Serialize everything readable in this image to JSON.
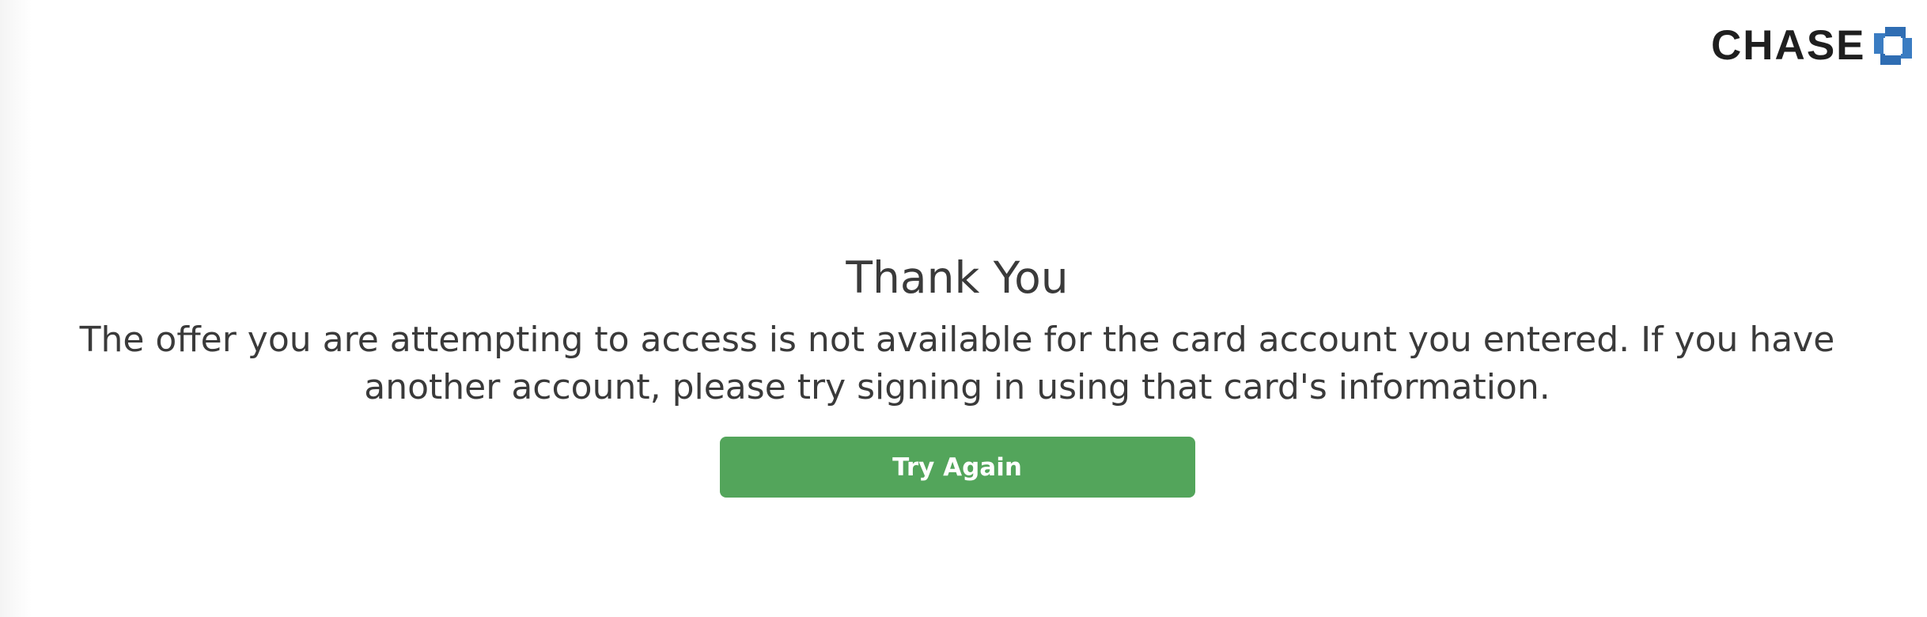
{
  "brand": {
    "name": "CHASE",
    "logo_icon": "chase-octagon-logo",
    "logo_color": "#2f6db3"
  },
  "page": {
    "title": "Thank You",
    "message": "The offer you are attempting to access is not available for the card account you entered. If you have another account, please try signing in using that card's information."
  },
  "actions": {
    "try_again_label": "Try Again",
    "button_color": "#53a55b"
  }
}
